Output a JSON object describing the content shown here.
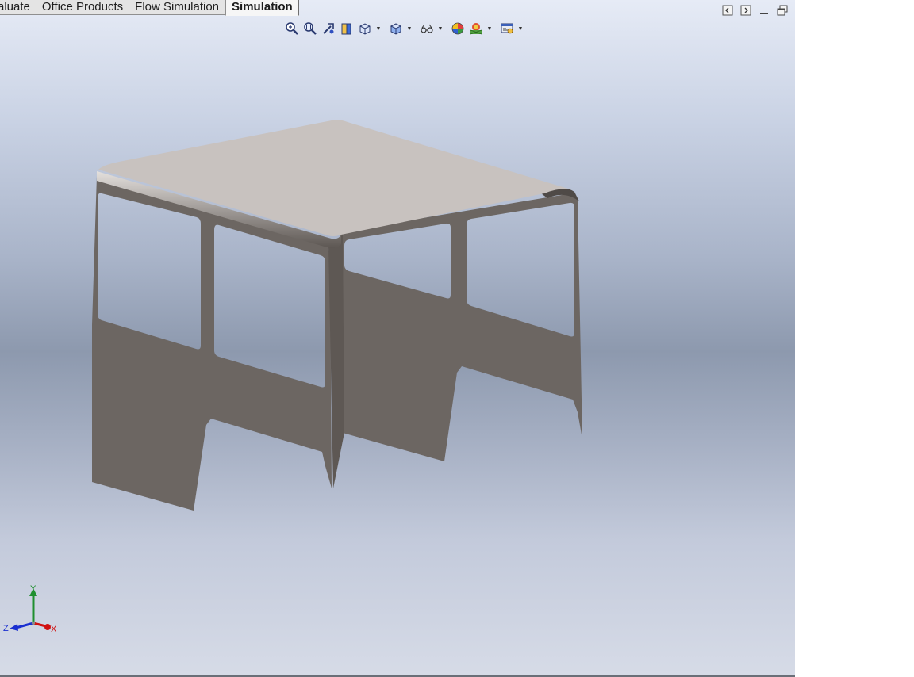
{
  "tabs": [
    {
      "label": "aluate",
      "active": false
    },
    {
      "label": "Office Products",
      "active": false
    },
    {
      "label": "Flow Simulation",
      "active": false
    },
    {
      "label": "Simulation",
      "active": true
    }
  ],
  "hud_toolbar": [
    {
      "icon": "zoom-to-fit-icon"
    },
    {
      "icon": "zoom-to-area-icon"
    },
    {
      "icon": "previous-view-icon"
    },
    {
      "icon": "section-view-icon"
    },
    {
      "icon": "dynamic-annotation-icon",
      "dropdown": true
    },
    {
      "icon": "view-orientation-icon",
      "dropdown": true
    },
    {
      "icon": "display-style-icon",
      "dropdown": true
    },
    {
      "icon": "hide-show-items-icon",
      "dropdown": true
    },
    {
      "icon": "edit-appearance-icon"
    },
    {
      "icon": "apply-scene-icon",
      "dropdown": true
    },
    {
      "icon": "view-settings-icon",
      "dropdown": true
    }
  ],
  "window_controls": [
    "tile-left-icon",
    "tile-right-icon",
    "minimize-icon",
    "restore-icon"
  ],
  "triad": {
    "x": "X",
    "y": "Y",
    "z": "Z"
  },
  "colors": {
    "roof": "#c8c2bf",
    "body": "#6c6662",
    "axis_x": "#d01010",
    "axis_y": "#1f8f2f",
    "axis_z": "#1a2fd0"
  }
}
